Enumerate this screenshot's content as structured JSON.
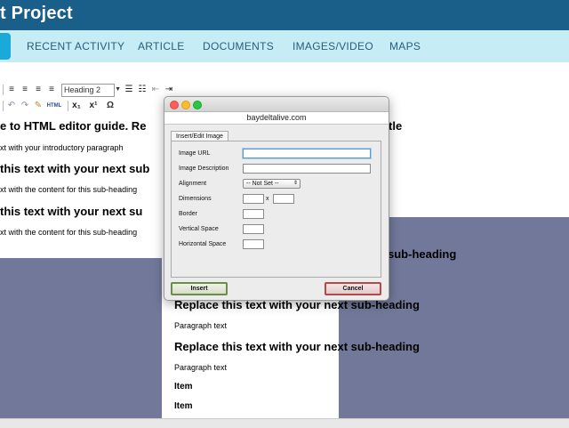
{
  "header": {
    "title": "t Project"
  },
  "nav": {
    "items": [
      {
        "label": "RECENT ACTIVITY"
      },
      {
        "label": "ARTICLE"
      },
      {
        "label": "DOCUMENTS"
      },
      {
        "label": "IMAGES/VIDEO"
      },
      {
        "label": "MAPS"
      }
    ]
  },
  "toolbar": {
    "format_value": "Heading 2",
    "html_label": "HTML",
    "omega": "Ω"
  },
  "content": {
    "title_line": "e to HTML editor guide. Re",
    "title_tail": "tle",
    "intro": "xt with your introductory paragraph",
    "sub1": "this text with your next sub",
    "sub1_para": "xt with the content for this sub-heading",
    "sub2": "this text with your next su",
    "sub2_para": "xt with the content for this sub-heading",
    "right_sub_tail": "sub-heading",
    "replace1": "Replace this text with your next sub-heading",
    "para1": "Paragraph text",
    "replace2": "Replace this text with your next sub-heading",
    "para2": "Paragraph text",
    "item1": "Item",
    "item2": "Item"
  },
  "dialog": {
    "url": "baydeltalive.com",
    "tab": "Insert/Edit Image",
    "fields": {
      "image_url": "Image URL",
      "image_description": "Image Description",
      "alignment": "Alignment",
      "alignment_value": "-- Not Set --",
      "dimensions": "Dimensions",
      "dim_x": "x",
      "border": "Border",
      "vertical_space": "Vertical Space",
      "horizontal_space": "Horizontal Space"
    },
    "insert_label": "Insert",
    "cancel_label": "Cancel"
  },
  "colors": {
    "header_bg": "#1a5e8a",
    "nav_bg": "#c6ecf5",
    "content_block": "#72789a"
  }
}
